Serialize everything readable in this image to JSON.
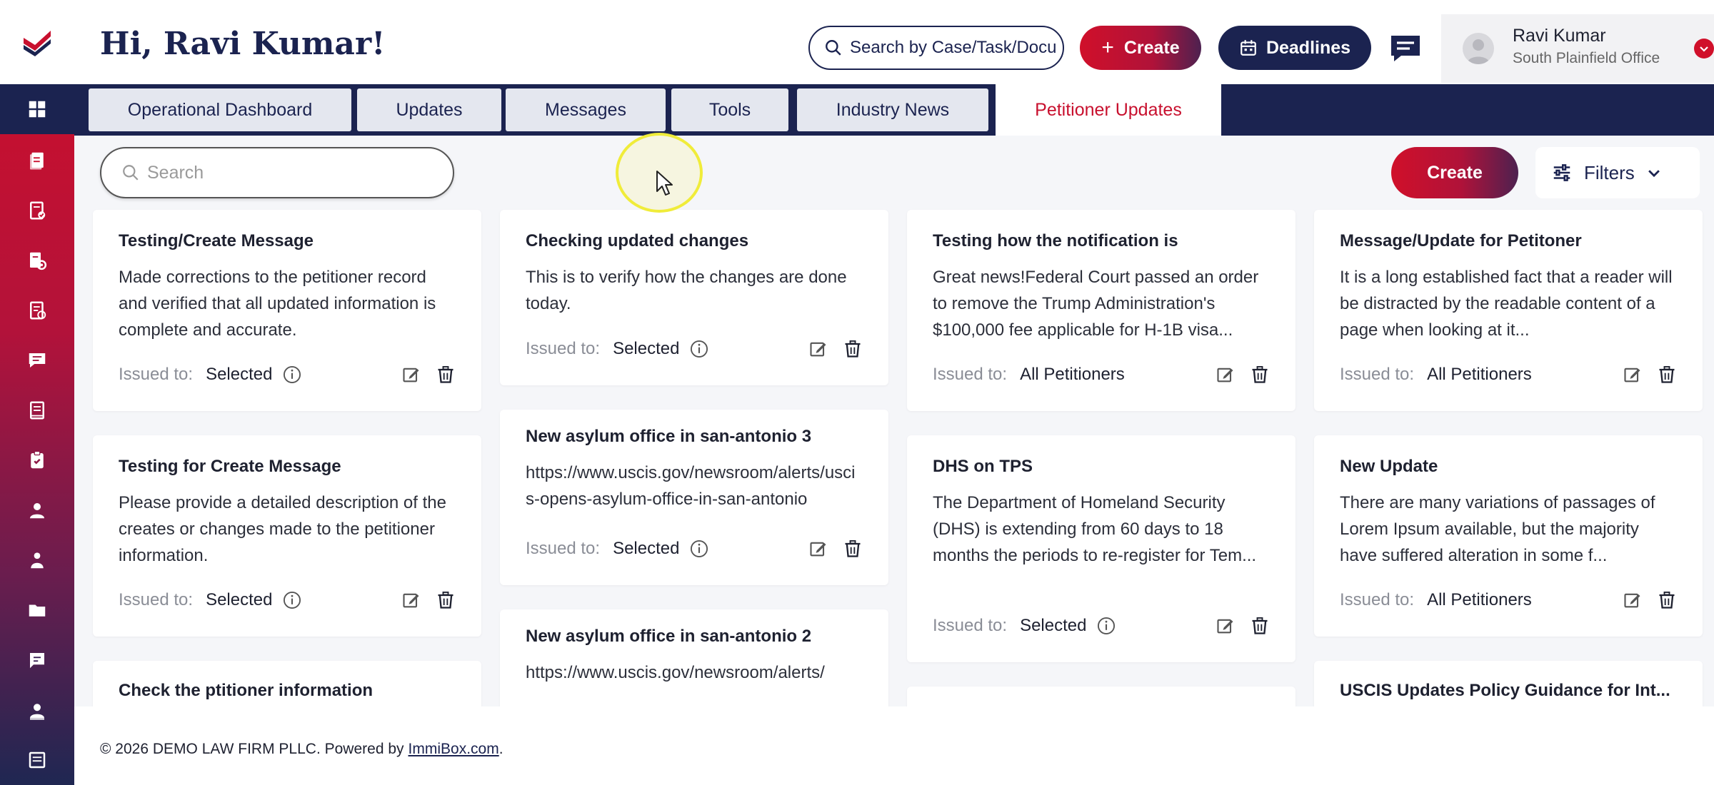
{
  "header": {
    "greeting": "Hi, Ravi Kumar!",
    "search_placeholder": "Search by Case/Task/Docu",
    "create_label": "Create",
    "deadlines_label": "Deadlines",
    "user": {
      "name": "Ravi Kumar",
      "office": "South Plainfield Office"
    }
  },
  "sidebar": {
    "items": [
      {
        "icon": "dashboard-icon",
        "active": true
      },
      {
        "icon": "documents-icon"
      },
      {
        "icon": "document-check-icon"
      },
      {
        "icon": "document-settings-icon"
      },
      {
        "icon": "document-approve-icon"
      },
      {
        "icon": "chat-icon"
      },
      {
        "icon": "book-icon"
      },
      {
        "icon": "clipboard-check-icon"
      },
      {
        "icon": "user-icon"
      },
      {
        "icon": "user-group-icon"
      },
      {
        "icon": "folder-icon"
      },
      {
        "icon": "message-square-icon"
      },
      {
        "icon": "profile-icon"
      },
      {
        "icon": "list-icon"
      }
    ]
  },
  "tabs": [
    {
      "label": "Operational Dashboard"
    },
    {
      "label": "Updates"
    },
    {
      "label": "Messages"
    },
    {
      "label": "Tools"
    },
    {
      "label": "Industry News"
    },
    {
      "label": "Petitioner Updates",
      "active": true
    }
  ],
  "toolbar": {
    "search_placeholder": "Search",
    "create_label": "Create",
    "filters_label": "Filters"
  },
  "cards": [
    {
      "title": "Testing/Create Message",
      "body": "Made corrections to the petitioner record and verified that all updated information is complete and accurate.",
      "issued_label": "Issued to:",
      "issued_to": "Selected",
      "info": true
    },
    {
      "title": "Checking updated changes",
      "body": "This is to verify how the changes are done today.",
      "issued_label": "Issued to:",
      "issued_to": "Selected",
      "info": true
    },
    {
      "title": "Testing how the notification is",
      "body": "Great news!Federal Court passed an order to remove the Trump Administration's $100,000 fee applicable for H-1B visa...",
      "issued_label": "Issued to:",
      "issued_to": "All Petitioners",
      "info": false
    },
    {
      "title": "Message/Update for Petitoner",
      "body": "It is a long established fact that a reader will be distracted by the readable content of a page when looking at it...",
      "issued_label": "Issued to:",
      "issued_to": "All Petitioners",
      "info": false
    },
    {
      "title": "Testing for Create Message",
      "body": "Please provide a detailed description of the creates or changes made to the petitioner information.",
      "issued_label": "Issued to:",
      "issued_to": "Selected",
      "info": true
    },
    {
      "title": "New asylum office in san-antonio 3",
      "body": "https://www.uscis.gov/newsroom/alerts/uscis-opens-asylum-office-in-san-antonio",
      "issued_label": "Issued to:",
      "issued_to": "Selected",
      "info": true
    },
    {
      "title": "DHS on TPS",
      "body": "The Department of Homeland Security (DHS) is extending from 60 days to 18 months the periods to re-register for Tem...",
      "issued_label": "Issued to:",
      "issued_to": "Selected",
      "info": true
    },
    {
      "title": "New Update",
      "body": "There are many variations of passages of Lorem Ipsum available, but the majority have suffered alteration in some f...",
      "issued_label": "Issued to:",
      "issued_to": "All Petitioners",
      "info": false
    },
    {
      "title": "Check the ptitioner information"
    },
    {
      "title": "New asylum office in san-antonio 2",
      "body": "https://www.uscis.gov/newsroom/alerts/"
    },
    {
      "title": "USCIS Updates Policy Guidance for Int..."
    }
  ],
  "footer": {
    "copyright": "© 2026 DEMO LAW FIRM PLLC. Powered by",
    "link": "ImmiBox.com",
    "period": "."
  },
  "colors": {
    "navy": "#1b2350",
    "brand_red": "#c8102e",
    "content_bg": "#f5f6f9"
  }
}
